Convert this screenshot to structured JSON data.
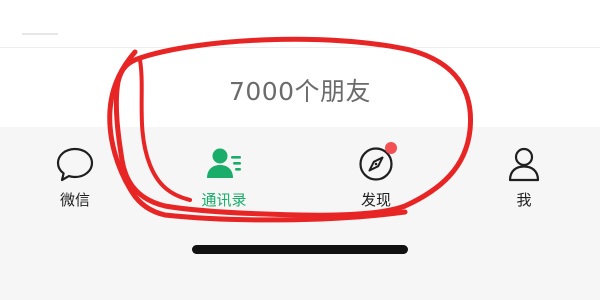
{
  "content": {
    "friend_count_text": "7000个朋友"
  },
  "tabbar": {
    "tabs": [
      {
        "label": "微信",
        "icon": "chat-bubble-icon",
        "active": false
      },
      {
        "label": "通讯录",
        "icon": "contacts-icon",
        "active": true
      },
      {
        "label": "发现",
        "icon": "compass-icon",
        "active": false,
        "badge": "red-dot"
      },
      {
        "label": "我",
        "icon": "person-icon",
        "active": false
      }
    ]
  },
  "colors": {
    "active_green": "#1aad6a",
    "badge_red": "#f25052",
    "annotation_red": "#e82525",
    "tabbar_bg": "#f6f6f6",
    "text_gray": "#6b6b6b"
  }
}
